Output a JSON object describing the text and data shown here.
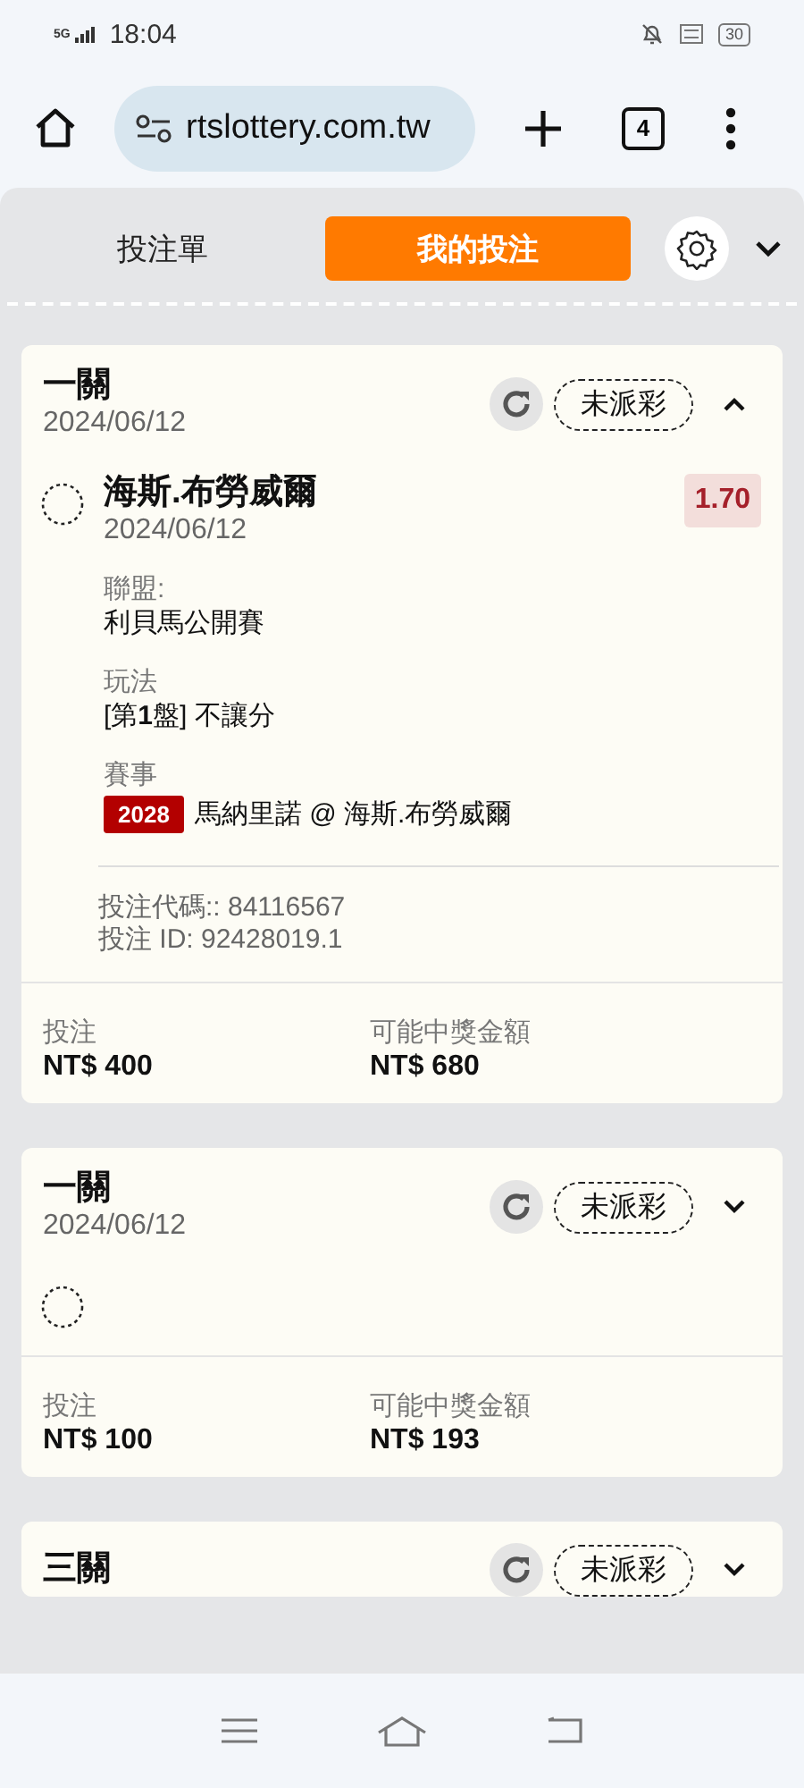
{
  "status_bar": {
    "network": "5G",
    "time": "18:04",
    "battery": "30"
  },
  "browser": {
    "url": "rtslottery.com.tw",
    "tab_count": "4"
  },
  "tabs": [
    {
      "label": "投注單",
      "selected": false
    },
    {
      "label": "我的投注",
      "selected": true
    }
  ],
  "bets": [
    {
      "title": "一關",
      "date": "2024/06/12",
      "status": "未派彩",
      "expanded": true,
      "selections": [
        {
          "kind": "detail",
          "name": "海斯.布勞威爾",
          "date": "2024/06/12",
          "odds": "1.70",
          "fields": [
            {
              "label": "聯盟:",
              "value": "利貝馬公開賽"
            },
            {
              "label": "玩法",
              "value": "[第**1**盤] 不讓分"
            }
          ],
          "event_label": "賽事",
          "event_code": "2028",
          "event_match": "馬納里諾 @ 海斯.布勞威爾",
          "codes": [
            "投注代碼:: 84116567",
            "投注 ID: 92428019.1"
          ]
        }
      ],
      "stake_label": "投注",
      "stake": "NT$ 400",
      "payout_label": "可能中獎金額",
      "payout": "NT$ 680"
    },
    {
      "title": "一關",
      "date": "2024/06/12",
      "status": "未派彩",
      "expanded": false,
      "selections": [
        {
          "kind": "pending"
        }
      ],
      "stake_label": "投注",
      "stake": "NT$ 100",
      "payout_label": "可能中獎金額",
      "payout": "NT$ 193"
    },
    {
      "title": "三關",
      "status": "未派彩",
      "expanded": false
    }
  ]
}
